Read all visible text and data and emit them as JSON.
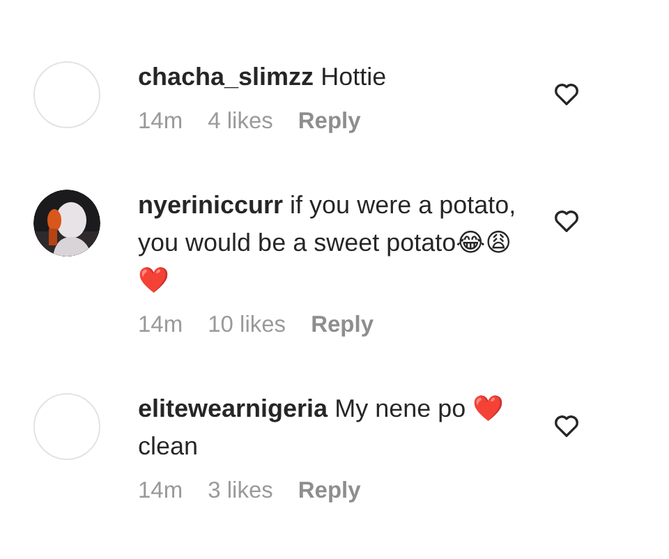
{
  "comments": [
    {
      "avatar": {
        "kind": "blank"
      },
      "username": "chacha_slimzz",
      "text": "Hottie",
      "time": "14m",
      "likes": "4 likes",
      "reply": "Reply"
    },
    {
      "username": "nyeriniccurr",
      "text": "if you were a potato, you would be a sweet potato😂😩❤️",
      "time": "14m",
      "likes": "10 likes",
      "reply": "Reply"
    },
    {
      "avatar": {
        "kind": "blank"
      },
      "username": "elitewearnigeria",
      "text": "My nene po ❤️clean",
      "time": "14m",
      "likes": "3 likes",
      "reply": "Reply"
    }
  ]
}
